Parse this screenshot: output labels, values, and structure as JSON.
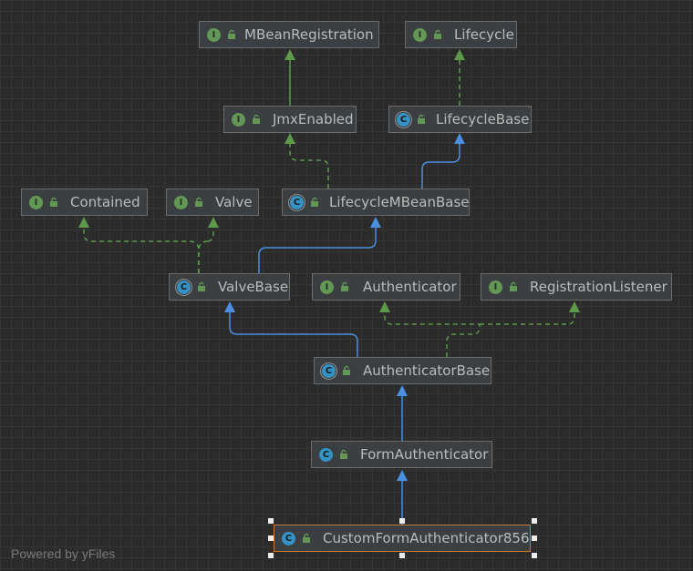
{
  "diagram": {
    "nodes": [
      {
        "id": "mbean",
        "kind": "interface",
        "badge": "I",
        "label": "MBeanRegistration"
      },
      {
        "id": "lifecycle",
        "kind": "interface",
        "badge": "I",
        "label": "Lifecycle"
      },
      {
        "id": "jmx",
        "kind": "interface",
        "badge": "I",
        "label": "JmxEnabled"
      },
      {
        "id": "lifecyclebase",
        "kind": "abstract-class",
        "badge": "C",
        "label": "LifecycleBase"
      },
      {
        "id": "contained",
        "kind": "interface",
        "badge": "I",
        "label": "Contained"
      },
      {
        "id": "valve",
        "kind": "interface",
        "badge": "I",
        "label": "Valve"
      },
      {
        "id": "lmbb",
        "kind": "abstract-class",
        "badge": "C",
        "label": "LifecycleMBeanBase"
      },
      {
        "id": "valvebase",
        "kind": "abstract-class",
        "badge": "C",
        "label": "ValveBase"
      },
      {
        "id": "auth",
        "kind": "interface",
        "badge": "I",
        "label": "Authenticator"
      },
      {
        "id": "reglistener",
        "kind": "interface",
        "badge": "I",
        "label": "RegistrationListener"
      },
      {
        "id": "authbase",
        "kind": "abstract-class",
        "badge": "C",
        "label": "AuthenticatorBase"
      },
      {
        "id": "formauth",
        "kind": "class",
        "badge": "C",
        "label": "FormAuthenticator"
      },
      {
        "id": "custom",
        "kind": "class",
        "badge": "C",
        "label": "CustomFormAuthenticator856",
        "selected": true
      }
    ],
    "edges": [
      {
        "from": "jmx",
        "to": "mbean",
        "type": "extends-interface"
      },
      {
        "from": "lifecyclebase",
        "to": "lifecycle",
        "type": "implements"
      },
      {
        "from": "lmbb",
        "to": "jmx",
        "type": "implements"
      },
      {
        "from": "lmbb",
        "to": "lifecyclebase",
        "type": "extends"
      },
      {
        "from": "valvebase",
        "to": "contained",
        "type": "implements"
      },
      {
        "from": "valvebase",
        "to": "valve",
        "type": "implements"
      },
      {
        "from": "valvebase",
        "to": "lmbb",
        "type": "extends"
      },
      {
        "from": "authbase",
        "to": "valvebase",
        "type": "extends"
      },
      {
        "from": "authbase",
        "to": "auth",
        "type": "implements"
      },
      {
        "from": "authbase",
        "to": "reglistener",
        "type": "implements"
      },
      {
        "from": "formauth",
        "to": "authbase",
        "type": "extends"
      },
      {
        "from": "custom",
        "to": "formauth",
        "type": "extends"
      }
    ]
  },
  "colors": {
    "interface_badge": "#629755",
    "class_badge": "#3592c4",
    "extends_edge": "#4a8fe0",
    "implements_edge": "#5c9a4a",
    "selection_border": "#c67d3a"
  },
  "watermark": "Powered by yFiles"
}
